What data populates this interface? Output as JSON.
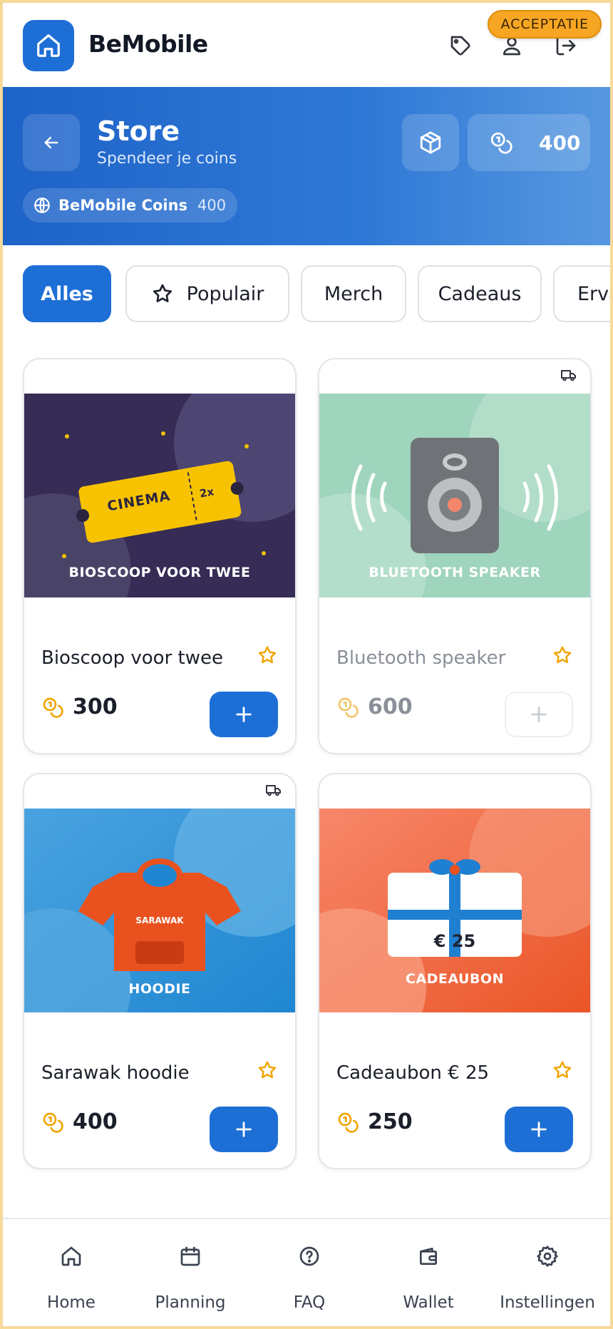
{
  "app": {
    "brand": "BeMobile",
    "env_badge": "ACCEPTATIE"
  },
  "header": {
    "title": "Store",
    "subtitle": "Spendeer je coins",
    "coin_balance": "400",
    "coins_chip": {
      "label": "BeMobile Coins",
      "value": "400"
    }
  },
  "filters": [
    {
      "label": "Alles",
      "active": true
    },
    {
      "label": "Populair",
      "icon": "star-outline-icon"
    },
    {
      "label": "Merch"
    },
    {
      "label": "Cadeaus"
    },
    {
      "label": "Ervaringen"
    }
  ],
  "products": [
    {
      "name": "Bioscoop voor twee",
      "price": "300",
      "image_caption": "BIOSCOOP VOOR TWEE",
      "ticket_text": "CINEMA",
      "ticket_count": "2x",
      "delivery_icon": false,
      "available": true
    },
    {
      "name": "Bluetooth speaker",
      "price": "600",
      "image_caption": "BLUETOOTH SPEAKER",
      "delivery_icon": true,
      "available": false
    },
    {
      "name": "Sarawak hoodie",
      "price": "400",
      "image_caption": "HOODIE",
      "shirt_text": "SARAWAK",
      "delivery_icon": true,
      "available": true
    },
    {
      "name": "Cadeaubon € 25",
      "price": "250",
      "image_caption": "CADEAUBON",
      "voucher_value": "€ 25",
      "delivery_icon": false,
      "available": true
    }
  ],
  "bottom_nav": [
    {
      "label": "Home",
      "icon": "home-icon"
    },
    {
      "label": "Planning",
      "icon": "calendar-icon"
    },
    {
      "label": "FAQ",
      "icon": "help-circle-icon"
    },
    {
      "label": "Wallet",
      "icon": "wallet-icon"
    },
    {
      "label": "Instellingen",
      "icon": "gear-icon"
    }
  ],
  "colors": {
    "primary": "#1d6fd6",
    "accent_coin": "#f0a500",
    "star": "#f0a500",
    "badge": "#f6a623"
  }
}
